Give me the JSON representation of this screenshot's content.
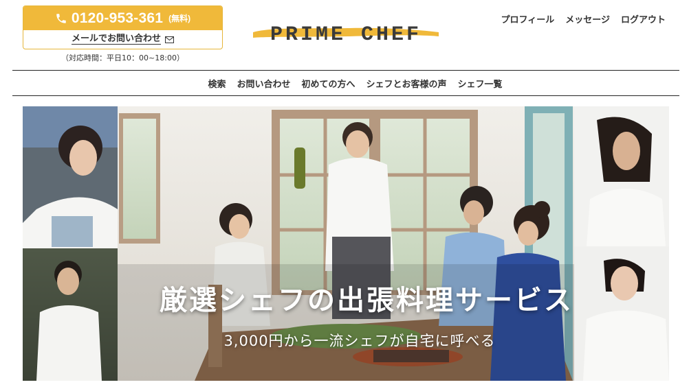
{
  "header": {
    "phone_number": "0120-953-361",
    "phone_free_label": "(無料)",
    "mail_label": "メールでお問い合わせ",
    "hours": "（対応時間：平日10：00~18:00）",
    "logo_text": "PRIME CHEF"
  },
  "top_nav": {
    "profile": "プロフィール",
    "message": "メッセージ",
    "logout": "ログアウト"
  },
  "main_nav": {
    "items": [
      "検索",
      "お問い合わせ",
      "初めての方へ",
      "シェフとお客様の声",
      "シェフ一覧"
    ]
  },
  "hero": {
    "title": "厳選シェフの出張料理サービス",
    "subtitle": "3,000円から一流シェフが自宅に呼べる"
  },
  "colors": {
    "accent": "#f0b93a",
    "text": "#333333"
  }
}
